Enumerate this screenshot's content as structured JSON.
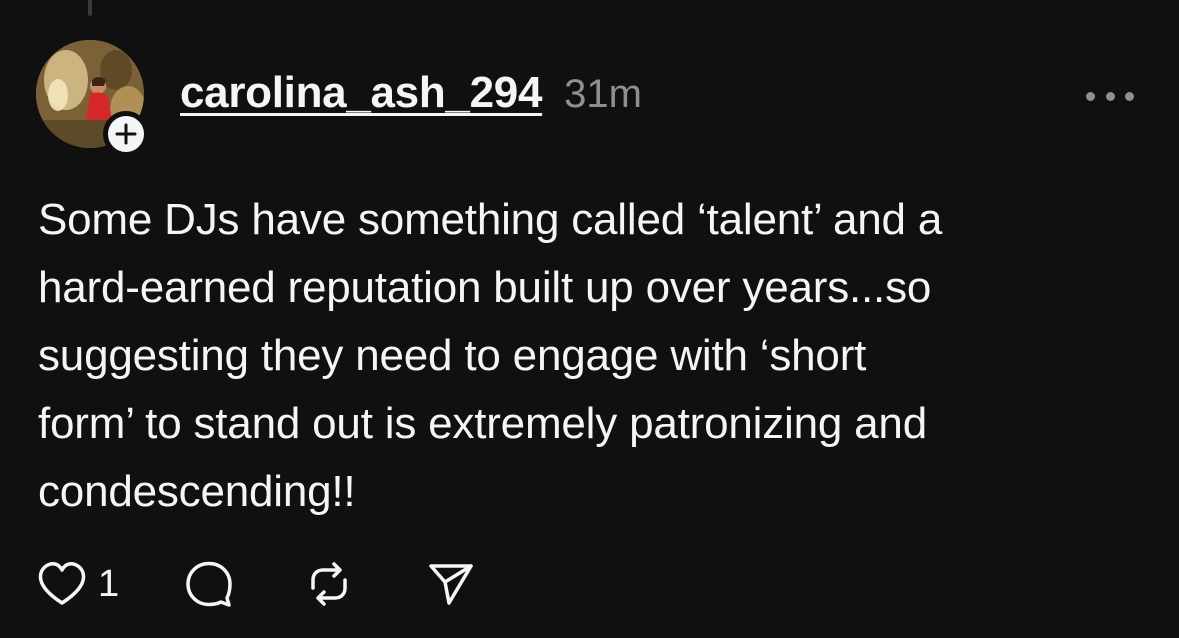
{
  "post": {
    "username": "carolina_ash_294",
    "timestamp": "31m",
    "body": "Some DJs have something called ‘talent’ and a\nhard-earned reputation built up over years...so\nsuggesting they need to engage with ‘short\nform’ to stand out is extremely patronizing and\ncondescending!!",
    "like_count": "1"
  },
  "icons": {
    "follow": "plus-icon",
    "more": "more-horizontal-icon",
    "like": "heart-icon",
    "comment": "comment-icon",
    "repost": "repost-icon",
    "share": "send-icon"
  },
  "colors": {
    "background": "#101010",
    "text_primary": "#f3f5f7",
    "text_secondary": "#8f8f8f"
  }
}
